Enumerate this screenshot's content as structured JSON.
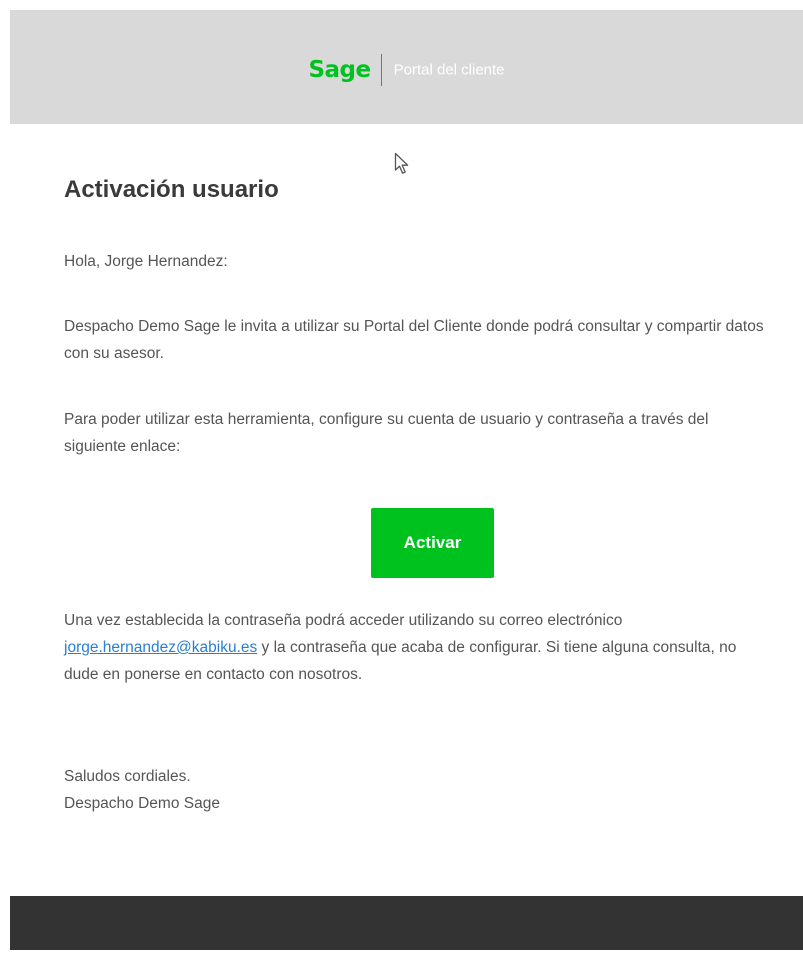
{
  "colors": {
    "header_bg": "#d9d9d9",
    "brand_green": "#00c21e",
    "portal_text": "#ffffff",
    "body_text": "#555555",
    "title_text": "#3a3a3a",
    "button_bg": "#00c21e",
    "link": "#2a7fd4",
    "footer_bg": "#333333"
  },
  "header": {
    "logo_text": "Sage",
    "portal_label": "Portal del cliente"
  },
  "email": {
    "title": "Activación usuario",
    "greeting": "Hola, Jorge Hernandez:",
    "invite": "Despacho Demo Sage le invita a utilizar su Portal del Cliente donde podrá consultar y compartir datos con su asesor.",
    "instructions": "Para poder utilizar esta herramienta, configure su cuenta de usuario y contraseña a través del siguiente enlace:",
    "button_label": "Activar",
    "after_pre": "Una vez establecida la contraseña podrá acceder utilizando su correo electrónico ",
    "email_address": "jorge.hernandez@kabiku.es",
    "after_post": " y la contraseña que acaba de configurar. Si tiene alguna consulta, no dude en ponerse en contacto con nosotros.",
    "closing": "Saludos cordiales.",
    "signature": "Despacho Demo Sage"
  },
  "icons": {
    "cursor": "mouse-pointer-icon"
  }
}
